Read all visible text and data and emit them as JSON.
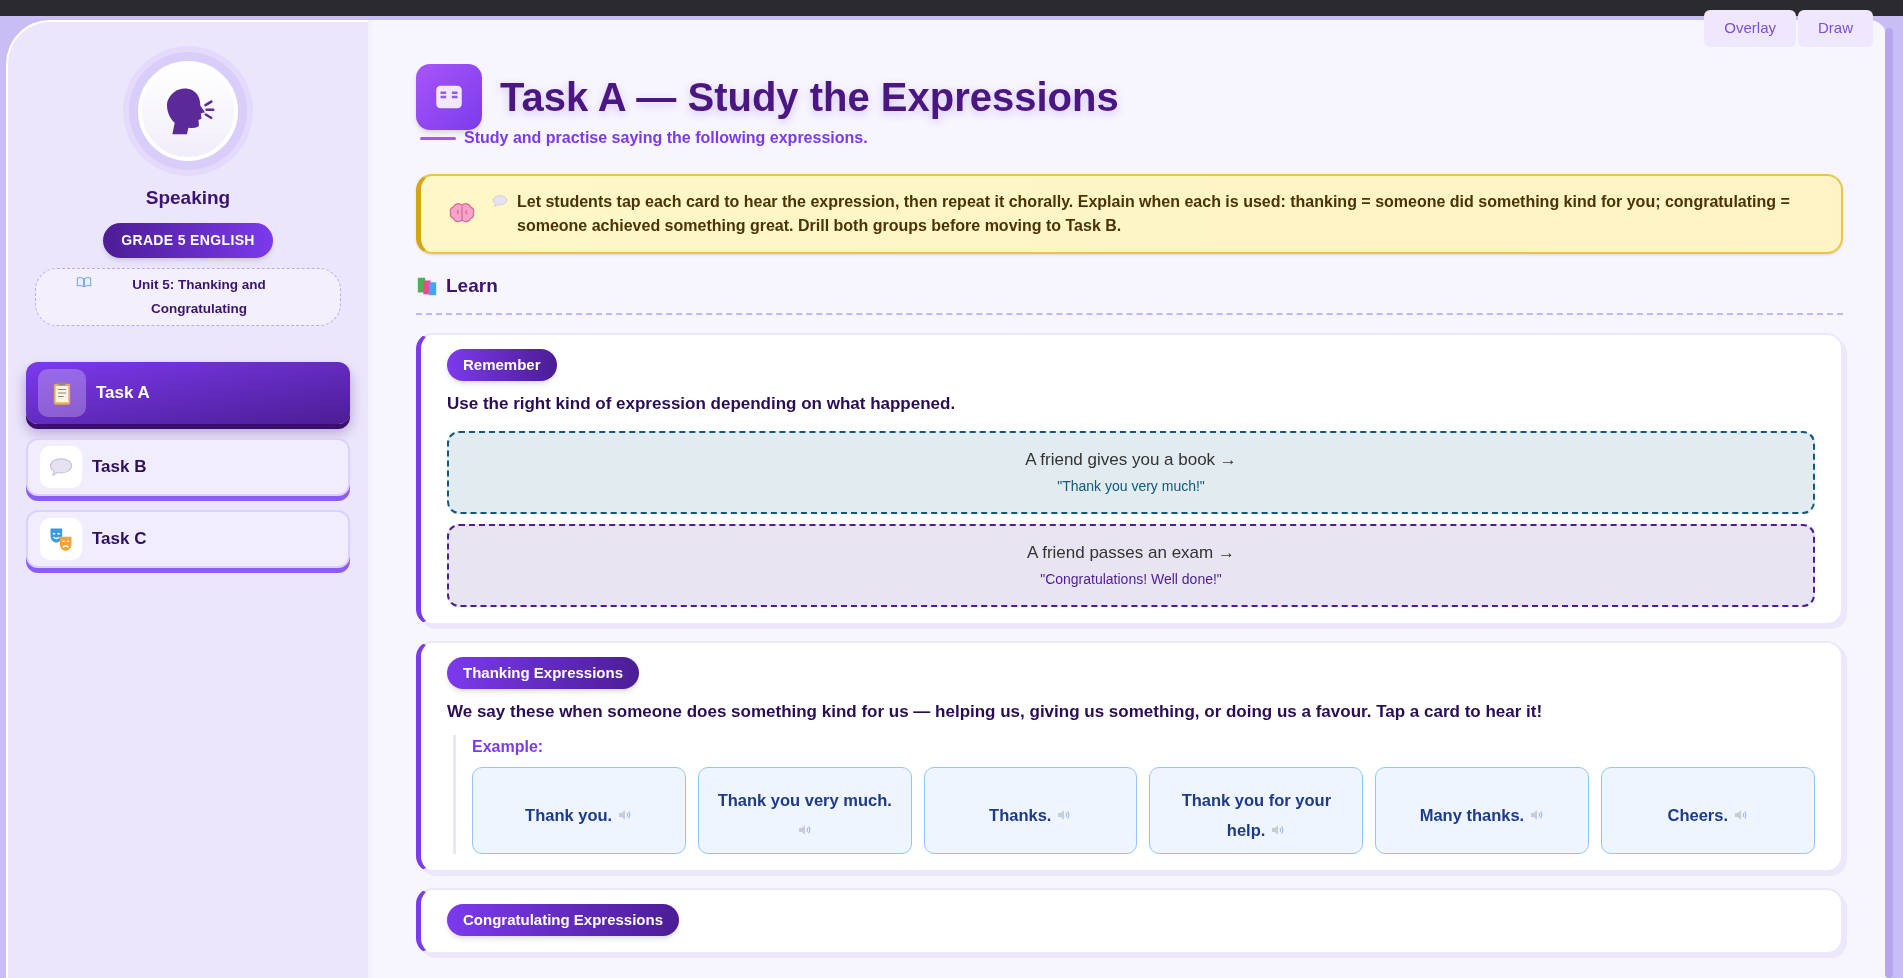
{
  "toolbar": {
    "buttons": [
      "Overlay",
      "Draw"
    ]
  },
  "sidebar": {
    "subject": "Speaking",
    "badge": "GRADE 5 ENGLISH",
    "unit": "Unit 5: Thanking and Congratulating",
    "tasks": [
      {
        "label": "Task A",
        "kind": "clipboard",
        "selected": true
      },
      {
        "label": "Task B",
        "kind": "speech",
        "selected": false
      },
      {
        "label": "Task C",
        "kind": "masks",
        "selected": false
      }
    ]
  },
  "header": {
    "title": "Task A — Study the Expressions",
    "subtitle": "Study and practise saying the following expressions."
  },
  "teacher_note": {
    "text": "Let students tap each card to hear the expression, then repeat it chorally. Explain when each is used: thanking = someone did something kind for you; congratulating = someone achieved something great. Drill both groups before moving to Task B."
  },
  "section": {
    "heading": "Learn"
  },
  "cards": [
    {
      "kind": "remember",
      "tag": "Remember",
      "text": "Use the right kind of expression depending on what happened.",
      "examples": [
        {
          "situation": "A friend gives you a book →",
          "response": "\"Thank you very much!\"",
          "color": "#0e5a7a"
        },
        {
          "situation": "A friend passes an exam →",
          "response": "\"Congratulations! Well done!\"",
          "color": "#4c1d95"
        }
      ]
    },
    {
      "kind": "expressions",
      "tag": "Thanking Expressions",
      "text": "We say these when someone does something kind for us — helping us, giving us something, or doing us a favour. Tap a card to hear it!",
      "example_label": "Example:",
      "expressions": [
        "Thank you.",
        "Thank you very much.",
        "Thanks.",
        "Thank you for your help.",
        "Many thanks.",
        "Cheers."
      ]
    },
    {
      "kind": "tag_only",
      "tag": "Congratulating Expressions"
    }
  ]
}
